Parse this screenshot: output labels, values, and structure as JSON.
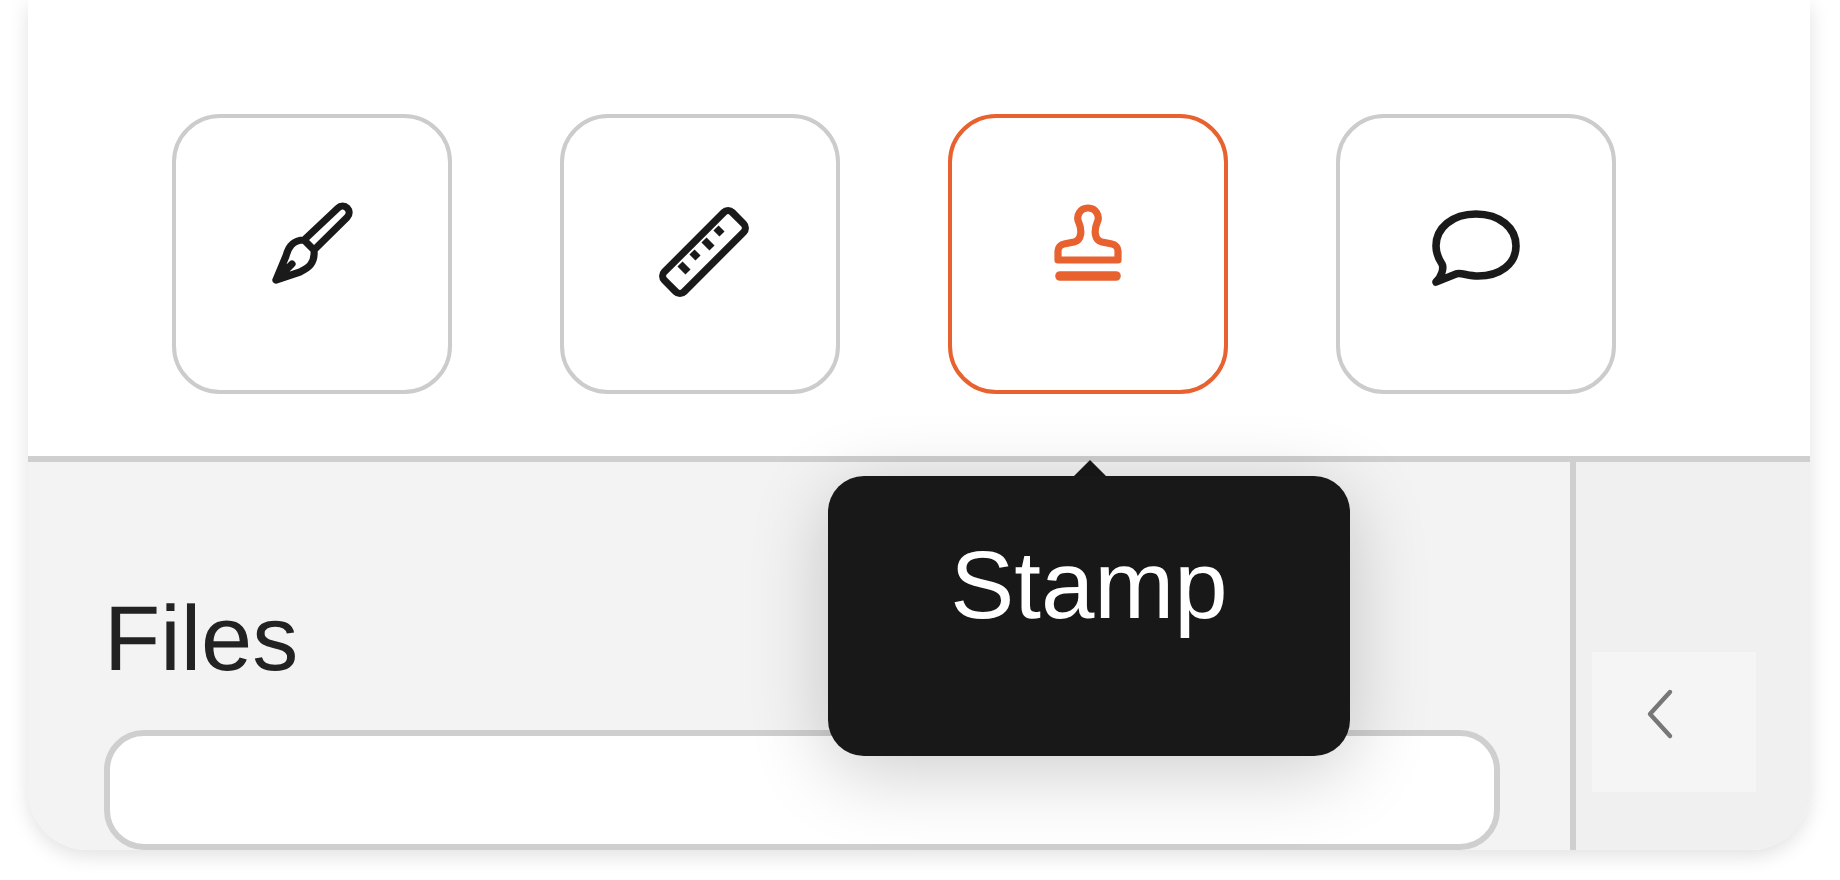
{
  "toolbar": {
    "tools": [
      {
        "kind": "pen",
        "selected": false
      },
      {
        "kind": "ruler",
        "selected": false
      },
      {
        "kind": "stamp",
        "selected": true
      },
      {
        "kind": "comment",
        "selected": false
      }
    ]
  },
  "tooltip": {
    "text": "Stamp"
  },
  "sidebar": {
    "title": "Files"
  }
}
